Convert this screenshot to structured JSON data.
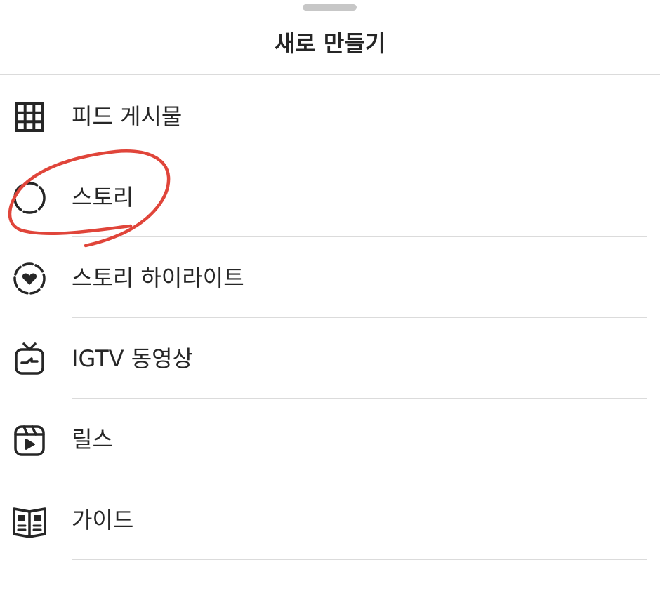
{
  "sheet": {
    "title": "새로 만들기"
  },
  "menu": {
    "items": [
      {
        "label": "피드 게시물",
        "icon": "grid-icon"
      },
      {
        "label": "스토리",
        "icon": "story-circle-icon"
      },
      {
        "label": "스토리 하이라이트",
        "icon": "story-highlight-heart-icon"
      },
      {
        "label": "IGTV 동영상",
        "icon": "igtv-icon"
      },
      {
        "label": "릴스",
        "icon": "reels-icon"
      },
      {
        "label": "가이드",
        "icon": "guide-book-icon"
      }
    ]
  },
  "colors": {
    "text": "#262626",
    "divider": "#dbdbdb",
    "handle": "#c7c7c7",
    "annotation": "#e0453a"
  }
}
